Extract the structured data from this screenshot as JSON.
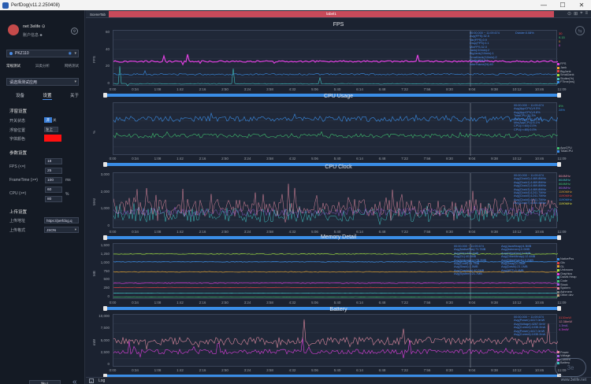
{
  "window": {
    "title": "PerfDog(v11.2.250408)",
    "minimize": "—",
    "maximize": "☐",
    "close": "✕"
  },
  "sidebar": {
    "user_name": "net 3elife ⊙",
    "user_info": "账户信息 ♣",
    "gear": "⚙",
    "device": "PKZ110",
    "device_caret": "▾",
    "modes": [
      "常规测试",
      "异类分析",
      "网络测试"
    ],
    "app_placeholder": "请选择测试应用",
    "app_caret": "▾",
    "sub_tabs": [
      "设备",
      "设置",
      "关于"
    ],
    "float_title": "浮窗设置",
    "float_switch_label": "开关状态",
    "switch_on": "开",
    "switch_off": "关",
    "float_pos_label": "浮窗位置",
    "float_pos_value": "左上",
    "font_color_label": "字体颜色",
    "font_color": "#ff1010",
    "param_title": "参数设置",
    "fps_label": "FPS (<=)",
    "fps_values": [
      "18",
      "25"
    ],
    "frametime_label": "FrameTime (>=)",
    "frametime_value": "100",
    "frametime_unit": "ms",
    "cpu_label": "CPU (>=)",
    "cpu_values": [
      "60",
      "80"
    ],
    "cpu_unit": "%",
    "upload_title": "上传设置",
    "upload_url_label": "上传地址",
    "upload_url_value": "https://perfdog.q",
    "upload_fmt_label": "上传格式",
    "upload_fmt_value": "JSON",
    "default_button": "默认",
    "collapse": "«"
  },
  "main": {
    "scene_tab": "SceneTab",
    "label_bar": "label1",
    "top_icons": [
      "⊙",
      "⊞",
      "⌖",
      "≡"
    ],
    "x_ticks": [
      "0:00",
      "0:34",
      "1:08",
      "1:42",
      "2:16",
      "2:50",
      "3:24",
      "3:58",
      "4:32",
      "5:06",
      "5:40",
      "6:14",
      "6:48",
      "7:22",
      "7:56",
      "8:30",
      "9:04",
      "9:38",
      "10:12",
      "10:46",
      "11:09"
    ],
    "log_label": "Log",
    "log_icon": "▸",
    "watermark": "www.3elife.net",
    "wm_logo": "3e",
    "side_arrow": "⇆"
  },
  "colors": {
    "fps": "#e040e0",
    "jank": "#f0a030",
    "stutter": "#40c0c0",
    "app_cpu": "#3a8de6",
    "total_cpu": "#40c070",
    "accent": "#3a8de6",
    "label_bar": "#c84a5a"
  },
  "charts": [
    {
      "title": "FPS",
      "y_name": "FPS",
      "y_ticks": [
        "60",
        "40",
        "20",
        "0"
      ],
      "stats": "00:00.000 ~ 11:09.674\nAvg(FPS):32.5\nVar(FPS):0.9\nDrop(FPS):0.1\nMinFPS:32.0\nJank(/10min):2\nBigJank(/10min):1\nSmallJank(/10min):2\nStutter(%):0.1\nInterFrame(%):40",
      "stats_right": "Divider:0.08%",
      "cur_vals": [
        {
          "text": "30",
          "color": "#ff3a3a"
        },
        {
          "text": "9.15",
          "color": "#40c070"
        },
        {
          "text": "0",
          "color": "#f0a030"
        },
        {
          "text": "0",
          "color": "#e040e0"
        }
      ],
      "legend": [
        {
          "name": "FPS",
          "color": "#e040e0"
        },
        {
          "name": "Jank",
          "color": "#f0a030"
        },
        {
          "name": "BigJank",
          "color": "#e04040"
        },
        {
          "name": "SmallJank",
          "color": "#a0e040"
        },
        {
          "name": "Stutter(%)",
          "color": "#40c0c0"
        },
        {
          "name": "FTime(ms)",
          "color": "#3a8de6"
        }
      ]
    },
    {
      "title": "CPU Usage",
      "y_name": "%",
      "y_ticks": [
        "",
        "",
        "",
        ""
      ],
      "stats": "00:00.000 ~ 11:09.674\nAvg(AppCPU):9.5%\nAvg(AppCPU):9.8%\nTotalCPU:31.3%\nMax(AppCPU):15.1%\nMin(AppCPU):6.1%\nCPU(>=60):0.0%\nCPU(>=80):0.0%",
      "stats_right": "",
      "cur_vals": [
        {
          "text": "8%",
          "color": "#40c070"
        },
        {
          "text": "28%",
          "color": "#3a8de6"
        }
      ],
      "legend": [
        {
          "name": "AppCPU",
          "color": "#40c070"
        },
        {
          "name": "TotalCPU",
          "color": "#3a8de6"
        }
      ]
    },
    {
      "title": "CPU Clock",
      "y_name": "MHz",
      "y_ticks": [
        "3,000",
        "2,000",
        "1,000",
        "0"
      ],
      "stats": "00:00.000 ~ 11:09.674\nAvg(Clock0):1469.8MHz\nAvg(Clock1):1469.8MHz\nAvg(Clock2):1469.8MHz\nAvg(Clock3):1469.8MHz\nAvg(Clock4):1241.7MHz\nAvg(Clock5):1241.7MHz\nAvg(Clock6):1241.7MHz\nAvg(Clock7):1340.4MHz",
      "stats_right": "",
      "cur_vals": [
        {
          "text": "864MHz",
          "color": "#e08aa0"
        },
        {
          "text": "864MHz",
          "color": "#40c0c0"
        },
        {
          "text": "864MHz",
          "color": "#40c070"
        },
        {
          "text": "864MHz",
          "color": "#a060e0"
        },
        {
          "text": "1190MHz",
          "color": "#e0a030"
        },
        {
          "text": "1190MHz",
          "color": "#e04040"
        },
        {
          "text": "1190MHz",
          "color": "#3a8de6"
        },
        {
          "text": "1190MHz",
          "color": "#e0e040"
        }
      ],
      "legend": []
    },
    {
      "title": "Memory Detail",
      "y_name": "MB",
      "y_ticks": [
        "1,500",
        "1,250",
        "1,000",
        "750",
        "500",
        "250",
        "0"
      ],
      "stats": "00:00.000 ~ 11:09.674\nAvg(NativePss):71.7MB\nAvg(Gfx):236.4MB\nAvg(GL):40.5MB\nAvg(Unknown):178.2MB\nAvg(Code):41.7MB\nAvg(Stack):1.5MB\nAvg(Graphics):40.5MB\nAvg(System):21.7MB",
      "stats_right": "Avg(JavaHeap):6.3MB\nAvg(Ashmem):0.0MB\nAvg(OtherDev):0.0MB\nAvg(OtherMmap):12.4MB\nAvg(OtherDalvik):2.2MB\nAvg(Swap):0.0MB\nAvg(Dalvik):21.1MB\nAvg(ART):0.4MB",
      "cur_vals": [],
      "legend": [
        {
          "name": "NativePss",
          "color": "#3a8de6"
        },
        {
          "name": "Gfx",
          "color": "#e04040"
        },
        {
          "name": "GL",
          "color": "#e0a030"
        },
        {
          "name": "Unknown",
          "color": "#a0e040"
        },
        {
          "name": "Graphics",
          "color": "#e040e0"
        },
        {
          "name": "Dalvik Heap",
          "color": "#40c0c0"
        },
        {
          "name": "Code",
          "color": "#40c070"
        },
        {
          "name": "Stack",
          "color": "#a060e0"
        },
        {
          "name": "System",
          "color": "#e08aa0"
        },
        {
          "name": "Ashmem",
          "color": "#808080"
        },
        {
          "name": "Other dev",
          "color": "#c0a080"
        }
      ]
    },
    {
      "title": "Battery",
      "y_name": "mW",
      "y_ticks": [
        "10,000",
        "7,500",
        "5,000",
        "2,500",
        "0"
      ],
      "stats": "00:00.000 ~ 11:09.674\nAvg(Power):4417.0mW\nAvg(Voltage):4267.0mV\nAvg(Current):1035.2mA\nAvg(Power):4417.0mW\nAvg(Current):1035.2mA",
      "stats_right": "",
      "cur_vals": [
        {
          "text": "3130mW",
          "color": "#e04040"
        },
        {
          "text": "12.38mW",
          "color": "#e08aa0"
        },
        {
          "text": "1.3mA",
          "color": "#a060e0"
        },
        {
          "text": "4.3mW",
          "color": "#e040e0"
        }
      ],
      "legend": [
        {
          "name": "Power",
          "color": "#e08aa0"
        },
        {
          "name": "Voltage",
          "color": "#a060e0"
        },
        {
          "name": "Current",
          "color": "#e040e0"
        },
        {
          "name": "Battery",
          "color": "#40c0c0"
        }
      ]
    }
  ]
}
